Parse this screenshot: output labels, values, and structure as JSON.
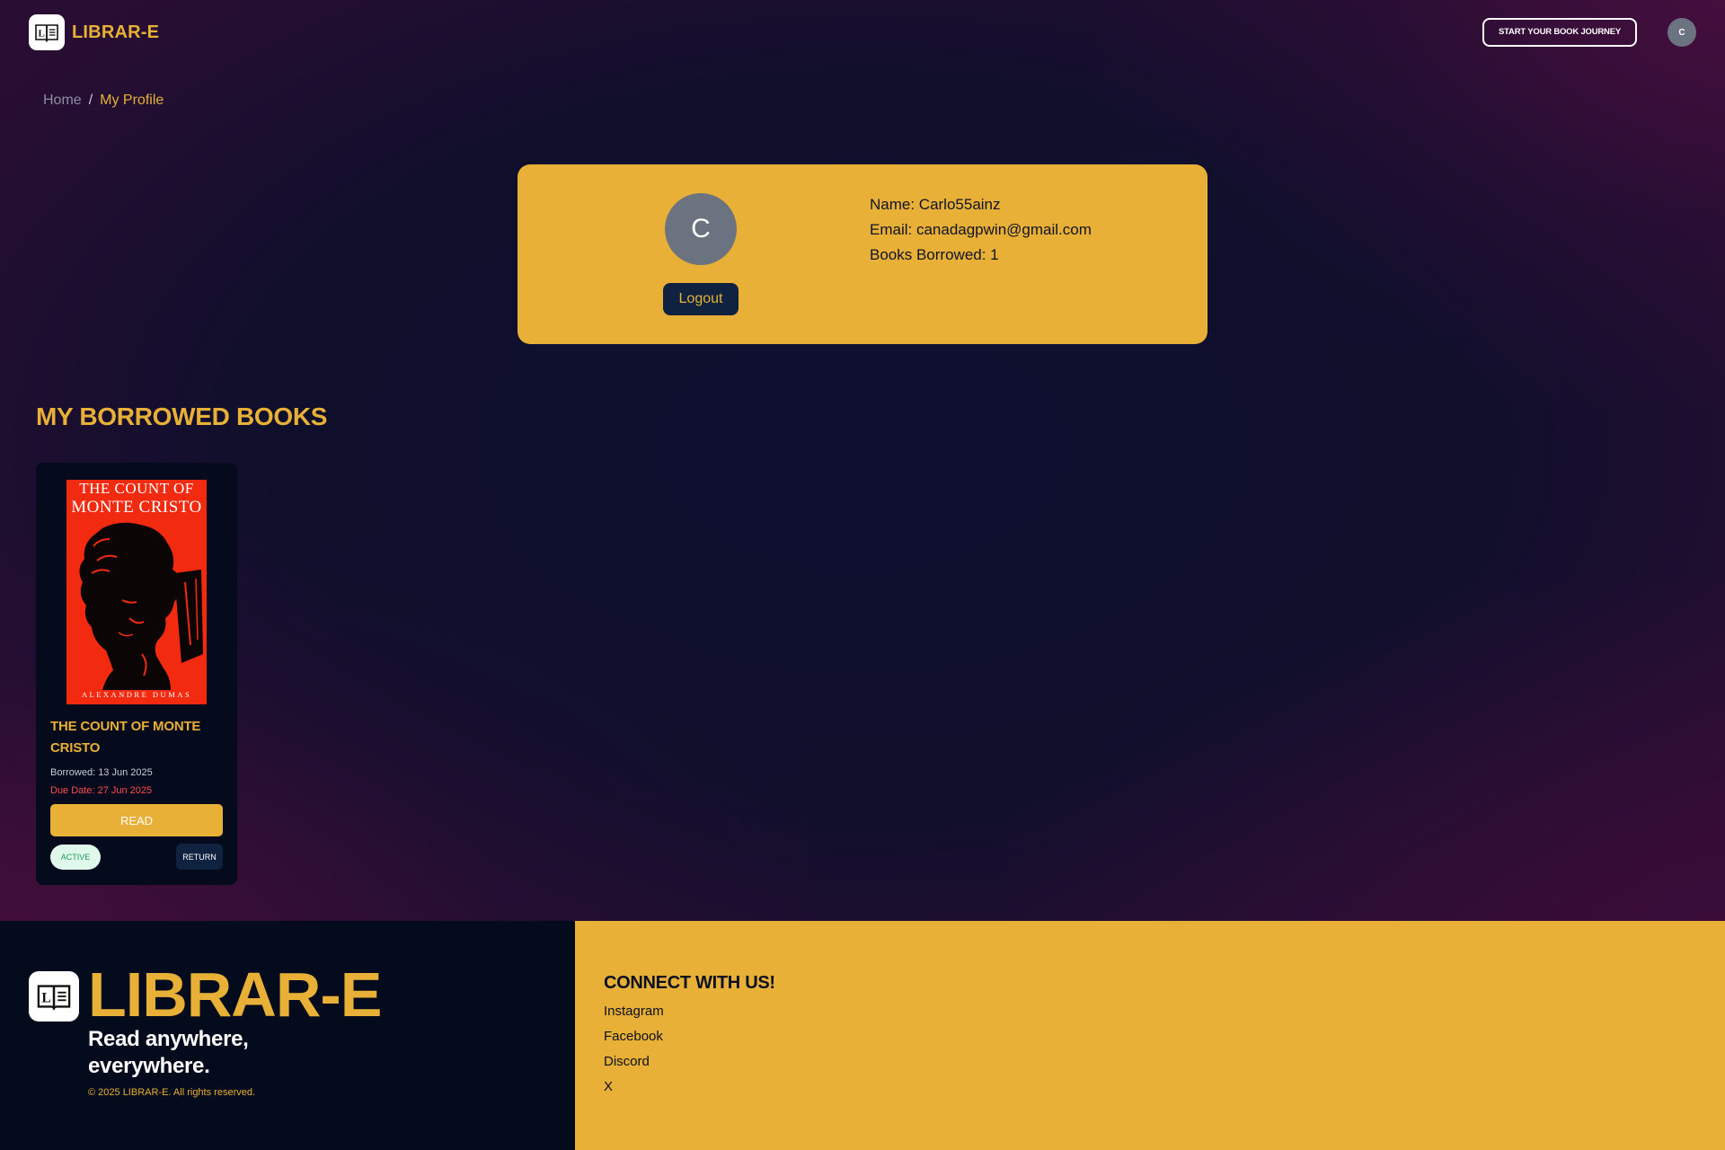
{
  "header": {
    "brand": "LIBRAR-E",
    "journey_button": "START YOUR BOOK JOURNEY",
    "avatar_initial": "C"
  },
  "breadcrumb": {
    "home": "Home",
    "separator": "/",
    "current": "My Profile"
  },
  "profile": {
    "avatar_initial": "C",
    "logout_label": "Logout",
    "name_line": "Name: Carlo55ainz",
    "email_line": "Email: canadagpwin@gmail.com",
    "books_line": "Books Borrowed: 1"
  },
  "borrowed": {
    "section_title": "MY BORROWED BOOKS",
    "books": [
      {
        "cover_line1": "THE COUNT OF",
        "cover_line2": "MONTE CRISTO",
        "cover_author": "ALEXANDRE DUMAS",
        "title": "THE COUNT OF MONTE CRISTO",
        "borrowed": "Borrowed: 13 Jun 2025",
        "due": "Due Date: 27 Jun 2025",
        "read_label": "READ",
        "status": "ACTIVE",
        "return_label": "RETURN"
      }
    ]
  },
  "footer": {
    "brand": "LIBRAR-E",
    "tagline": "Read anywhere, everywhere.",
    "copyright": "© 2025 LIBRAR-E. All rights reserved.",
    "connect_title": "CONNECT WITH US!",
    "social": [
      "Instagram",
      "Facebook",
      "Discord",
      "X"
    ]
  },
  "colors": {
    "accent": "#e8b036",
    "background": "#100f2c",
    "navy_button": "#0f2340",
    "due_red": "#ff4d4d",
    "active_green": "#1f9d5a",
    "avatar_gray": "#6b7280"
  },
  "icons": {
    "logo": "open-book-icon"
  }
}
